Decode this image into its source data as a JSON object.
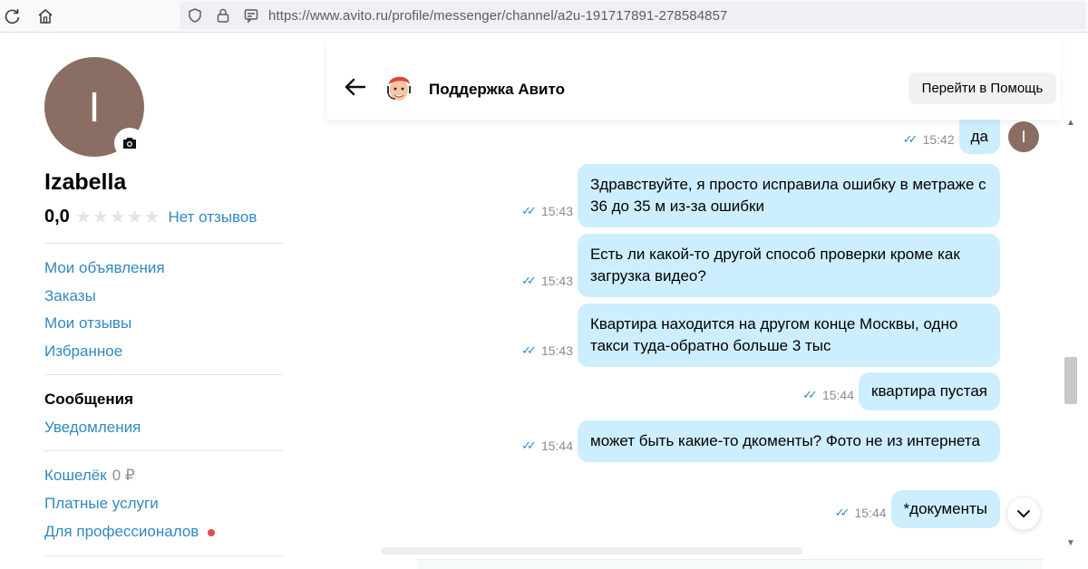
{
  "browser": {
    "url": "https://www.avito.ru/profile/messenger/channel/a2u-191717891-278584857"
  },
  "sidebar": {
    "avatar_letter": "I",
    "user_name": "Izabella",
    "rating_value": "0,0",
    "stars": 5,
    "stars_filled": 0,
    "reviews_link": "Нет отзывов",
    "group1": [
      "Мои объявления",
      "Заказы",
      "Мои отзывы",
      "Избранное"
    ],
    "messages_label": "Сообщения",
    "notifications_label": "Уведомления",
    "wallet_label": "Кошелёк",
    "wallet_amount": "0 ₽",
    "paid_services": "Платные услуги",
    "for_pros": "Для профессионалов"
  },
  "chat": {
    "title": "Поддержка Авито",
    "help_button": "Перейти в Помощь",
    "my_avatar_letter": "I",
    "messages": [
      {
        "time": "15:42",
        "text": "да"
      },
      {
        "time": "15:43",
        "text": "Здравствуйте, я просто исправила ошибку в метраже с 36 до 35 м из-за ошибки"
      },
      {
        "time": "15:43",
        "text": "Есть ли какой-то другой способ проверки кроме как загрузка видео?"
      },
      {
        "time": "15:43",
        "text": "Квартира находится на другом конце Москвы, одно такси туда-обратно больше 3 тыс"
      },
      {
        "time": "15:44",
        "text": "квартира пустая"
      },
      {
        "time": "15:44",
        "text": "может быть какие-то дкоменты? Фото не из интернета"
      },
      {
        "time": "15:44",
        "text": "*документы"
      }
    ]
  },
  "colors": {
    "link": "#3189c1",
    "bubble": "#cdeeff",
    "avatar": "#8b6e63",
    "notification_dot": "#e24a4a"
  }
}
